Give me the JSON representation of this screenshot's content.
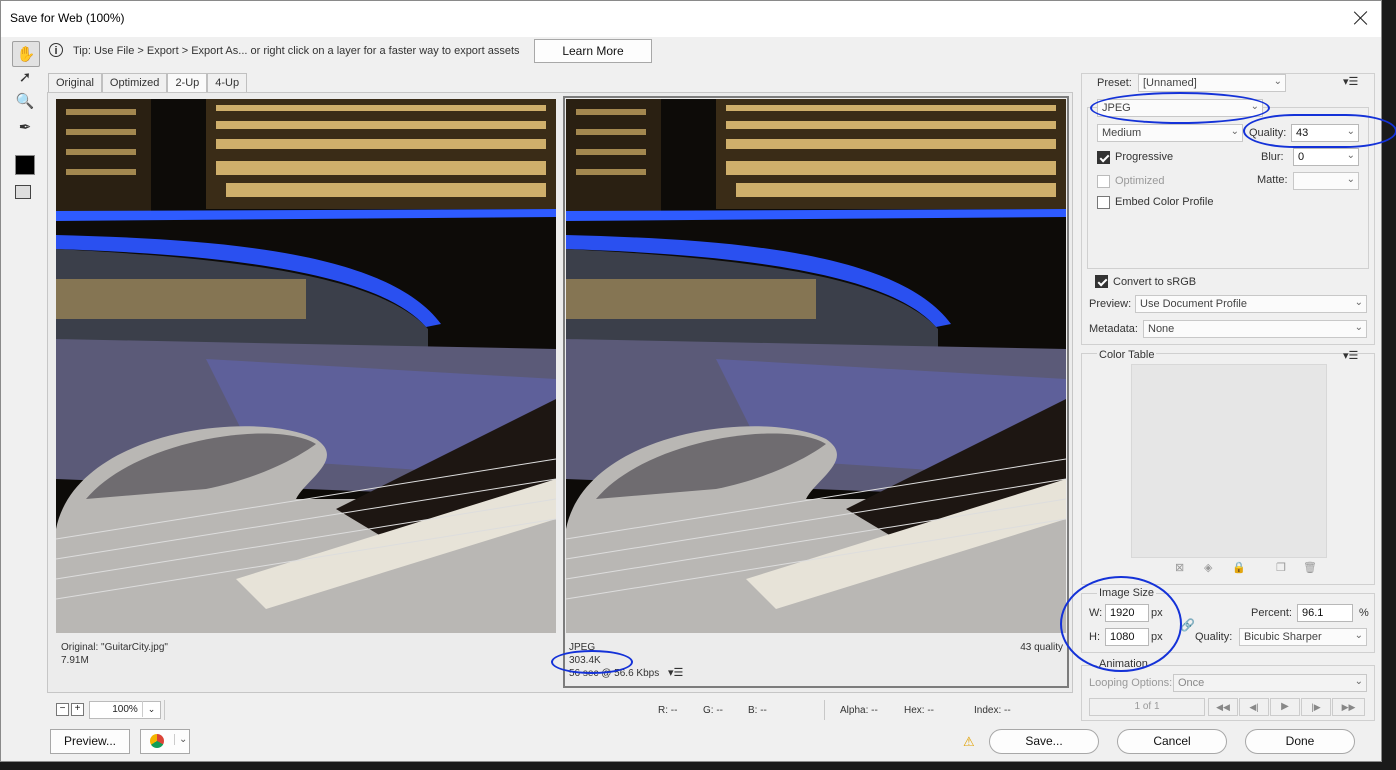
{
  "window": {
    "title": "Save for Web (100%)"
  },
  "tip": {
    "text": "Tip: Use File > Export > Export As...  or right click on a layer for a faster way to export assets",
    "learn_more": "Learn More"
  },
  "view_tabs": [
    "Original",
    "Optimized",
    "2-Up",
    "4-Up"
  ],
  "original_pane": {
    "line1": "Original: \"GuitarCity.jpg\"",
    "line2": "7.91M"
  },
  "optimized_pane": {
    "format": "JPEG",
    "size": "303.4K",
    "time": "56 sec @ 56.6 Kbps",
    "quality": "43 quality"
  },
  "status": {
    "zoom": "100%",
    "r": "R: --",
    "g": "G: --",
    "b": "B: --",
    "alpha": "Alpha: --",
    "hex": "Hex: --",
    "index": "Index: --"
  },
  "settings": {
    "preset_label": "Preset:",
    "preset_value": "[Unnamed]",
    "format": "JPEG",
    "quality_level": "Medium",
    "quality_label": "Quality:",
    "quality_value": "43",
    "progressive": "Progressive",
    "blur_label": "Blur:",
    "blur_value": "0",
    "optimized": "Optimized",
    "matte_label": "Matte:",
    "embed_profile": "Embed Color Profile",
    "convert_srgb": "Convert to sRGB",
    "preview_label": "Preview:",
    "preview_value": "Use Document Profile",
    "metadata_label": "Metadata:",
    "metadata_value": "None"
  },
  "color_table": {
    "title": "Color Table"
  },
  "image_size": {
    "title": "Image Size",
    "w_label": "W:",
    "w_value": "1920",
    "w_unit": "px",
    "h_label": "H:",
    "h_value": "1080",
    "h_unit": "px",
    "percent_label": "Percent:",
    "percent_value": "96.1",
    "percent_unit": "%",
    "quality_label": "Quality:",
    "quality_value": "Bicubic Sharper"
  },
  "animation": {
    "title": "Animation",
    "looping_label": "Looping Options:",
    "looping_value": "Once",
    "frame": "1 of 1"
  },
  "buttons": {
    "preview": "Preview...",
    "save": "Save...",
    "cancel": "Cancel",
    "done": "Done"
  }
}
